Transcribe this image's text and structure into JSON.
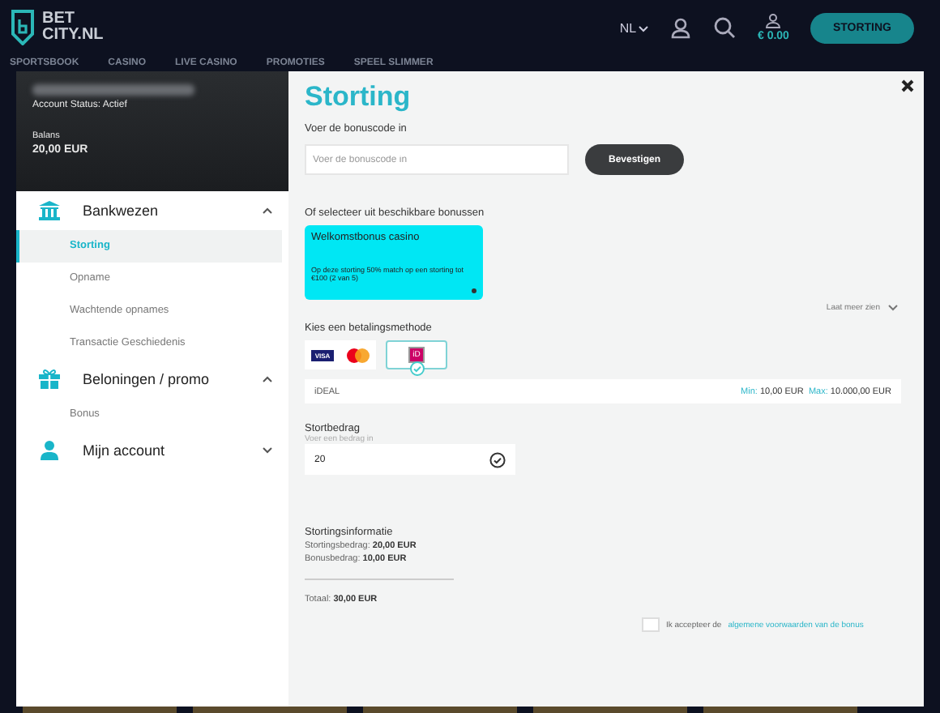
{
  "header": {
    "logo_top": "BET",
    "logo_bottom": "CITY.NL",
    "language": "NL",
    "balance": "€ 0.00",
    "deposit_button": "STORTING",
    "nav": [
      "SPORTSBOOK",
      "CASINO",
      "LIVE CASINO",
      "PROMOTIES",
      "SPEEL SLIMMER"
    ]
  },
  "sidebar": {
    "account_status": "Account Status: Actief",
    "balance_label": "Balans",
    "balance_value": "20,00 EUR",
    "sections": [
      {
        "label": "Bankwezen",
        "expanded": true,
        "items": [
          {
            "label": "Storting",
            "selected": true
          },
          {
            "label": "Opname",
            "selected": false
          },
          {
            "label": "Wachtende opnames",
            "selected": false
          },
          {
            "label": "Transactie Geschiedenis",
            "selected": false
          }
        ]
      },
      {
        "label": "Beloningen / promo",
        "expanded": true,
        "items": [
          {
            "label": "Bonus",
            "selected": false
          }
        ]
      },
      {
        "label": "Mijn account",
        "expanded": false
      }
    ]
  },
  "main": {
    "title": "Storting",
    "bonus_code_label": "Voer de bonuscode in",
    "bonus_code_placeholder": "Voer de bonuscode in",
    "confirm_button": "Bevestigen",
    "bonus_list_label": "Of selecteer uit beschikbare bonussen",
    "bonuses": [
      {
        "title": "Welkomstbonus casino",
        "description": "Op deze storting 50% match op een storting tot €100 (2 van 5)"
      }
    ],
    "show_more": "Laat meer zien",
    "payment_label": "Kies een betalingsmethode",
    "payment_methods": [
      {
        "kind": "visa",
        "label": "VISA",
        "selected": false
      },
      {
        "kind": "mastercard",
        "selected": false
      },
      {
        "kind": "ideal",
        "label": "iD",
        "selected": true
      }
    ],
    "method_name": "iDEAL",
    "min_label": "Min:",
    "min_value": "10,00 EUR",
    "max_label": "Max:",
    "max_value": "10.000,00 EUR",
    "amount_label": "Stortbedrag",
    "amount_hint": "Voer een bedrag in",
    "amount_value": "20",
    "info_title": "Stortingsinformatie",
    "info_lines": [
      {
        "label": "Stortingsbedrag:",
        "value": "20,00 EUR"
      },
      {
        "label": "Bonusbedrag:",
        "value": "10,00 EUR"
      }
    ],
    "total_label": "Totaal:",
    "total_value": "30,00 EUR",
    "terms_text": "Ik accepteer de",
    "terms_link": "algemene voorwaarden van de bonus",
    "terms_checked": false
  }
}
